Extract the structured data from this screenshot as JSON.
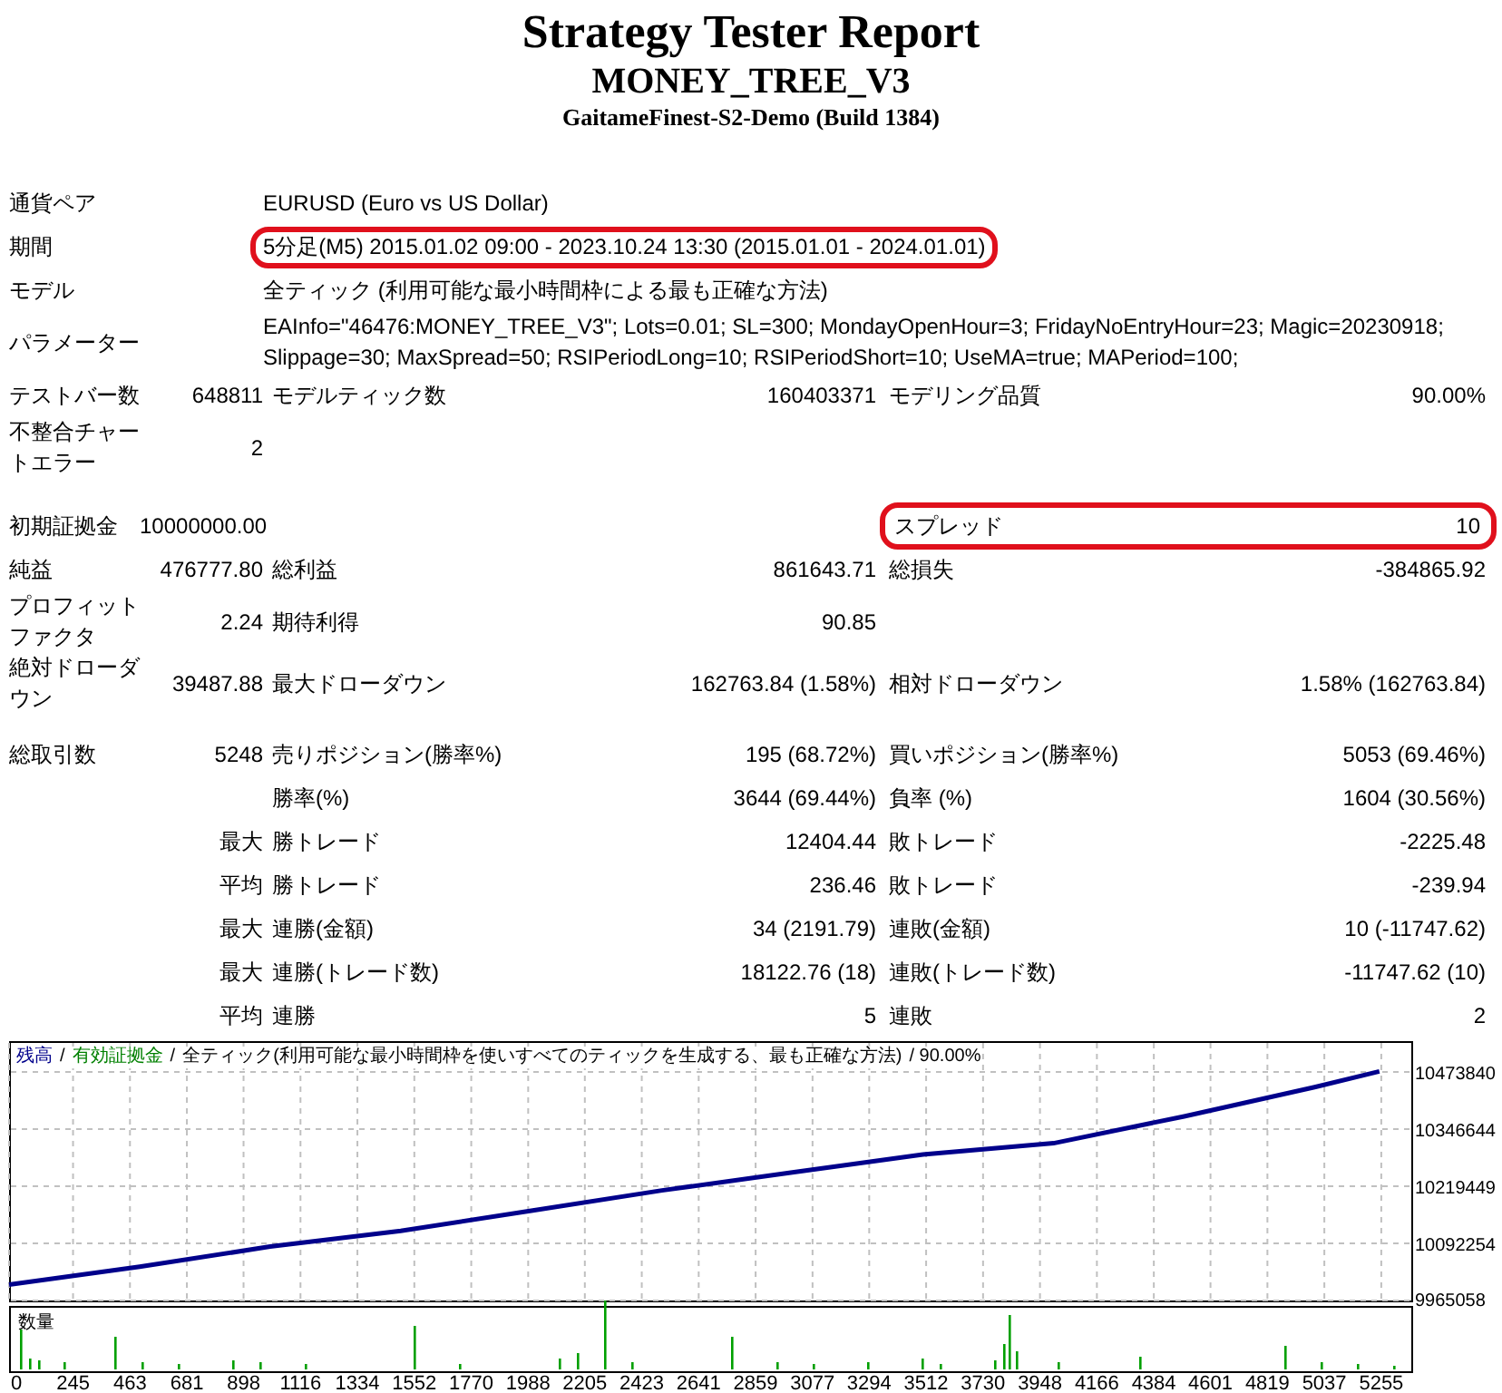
{
  "header": {
    "title": "Strategy Tester Report",
    "subtitle": "MONEY_TREE_V3",
    "server": "GaitameFinest-S2-Demo (Build 1384)"
  },
  "settings": [
    {
      "label": "通貨ペア",
      "value": "EURUSD (Euro vs US Dollar)",
      "highlighted": false
    },
    {
      "label": "期間",
      "value": "5分足(M5) 2015.01.02 09:00 - 2023.10.24 13:30 (2015.01.01 - 2024.01.01)",
      "highlighted": true
    },
    {
      "label": "モデル",
      "value": "全ティック (利用可能な最小時間枠による最も正確な方法)",
      "highlighted": false
    },
    {
      "label": "パラメーター",
      "value": "EAInfo=\"46476:MONEY_TREE_V3\"; Lots=0.01; SL=300; MondayOpenHour=3; FridayNoEntryHour=23; Magic=20230918; Slippage=30; MaxSpread=50; RSIPeriodLong=10; RSIPeriodShort=10; UseMA=true; MAPeriod=100;",
      "highlighted": false
    }
  ],
  "stat_groups": [
    [
      {
        "label_1": "テストバー数",
        "value_1": "648811",
        "label_2": "モデルティック数",
        "value_2": "160403371",
        "label_3": "モデリング品質",
        "value_3": "90.00%",
        "highlighted_3": false
      },
      {
        "label_1": "不整合チャートエラー",
        "value_1": "2",
        "highlighted_3": false
      }
    ],
    [
      {
        "label_1": "初期証拠金",
        "value_1": "10000000.00",
        "label_3": "スプレッド",
        "value_3": "10",
        "highlighted_3": true
      },
      {
        "label_1": "純益",
        "value_1": "476777.80",
        "label_2": "総利益",
        "value_2": "861643.71",
        "label_3": "総損失",
        "value_3": "-384865.92",
        "highlighted_3": false
      },
      {
        "label_1": "プロフィットファクタ",
        "value_1": "2.24",
        "label_2": "期待利得",
        "value_2": "90.85",
        "highlighted_3": false
      },
      {
        "label_1": "絶対ドローダウン",
        "value_1": "39487.88",
        "label_2": "最大ドローダウン",
        "value_2": "162763.84 (1.58%)",
        "label_3": "相対ドローダウン",
        "value_3": "1.58% (162763.84)",
        "highlighted_3": false
      }
    ],
    [
      {
        "label_1": "総取引数",
        "value_1": "5248",
        "label_2": "売りポジション(勝率%)",
        "value_2": "195 (68.72%)",
        "label_3": "買いポジション(勝率%)",
        "value_3": "5053 (69.46%)",
        "highlighted_3": false
      },
      {
        "label_2": "勝率(%)",
        "value_2": "3644 (69.44%)",
        "label_3": "負率 (%)",
        "value_3": "1604 (30.56%)",
        "highlighted_3": false
      },
      {
        "value_1": "最大",
        "label_2": "勝トレード",
        "value_2": "12404.44",
        "label_3": "敗トレード",
        "value_3": "-2225.48",
        "highlighted_3": false
      },
      {
        "value_1": "平均",
        "label_2": "勝トレード",
        "value_2": "236.46",
        "label_3": "敗トレード",
        "value_3": "-239.94",
        "highlighted_3": false
      },
      {
        "value_1": "最大",
        "label_2": "連勝(金額)",
        "value_2": "34 (2191.79)",
        "label_3": "連敗(金額)",
        "value_3": "10 (-11747.62)",
        "highlighted_3": false
      },
      {
        "value_1": "最大",
        "label_2": "連勝(トレード数)",
        "value_2": "18122.76 (18)",
        "label_3": "連敗(トレード数)",
        "value_3": "-11747.62 (10)",
        "highlighted_3": false
      },
      {
        "value_1": "平均",
        "label_2": "連勝",
        "value_2": "5",
        "label_3": "連敗",
        "value_3": "2",
        "highlighted_3": false
      }
    ]
  ],
  "chart": {
    "legend": [
      {
        "text": "/",
        "color": "#000000"
      },
      {
        "text": "有効証拠金",
        "color": "#008000"
      },
      {
        "text": "/",
        "color": "#000000"
      },
      {
        "text": "全ティック(利用可能な最小時間枠を使いすべてのティックを生成する、最も正確な方法)",
        "color": "#000000"
      },
      {
        "text": "/ 90.00%",
        "color": "#000000"
      }
    ],
    "volume_label": "数量",
    "chart_data": {
      "type": "line",
      "x": [
        0,
        500,
        1000,
        1500,
        2000,
        2500,
        3000,
        3500,
        4000,
        4500,
        5000,
        5248
      ],
      "series": [
        {
          "name": "残高",
          "color": "#00008b",
          "values": [
            10000000,
            10040000,
            10085000,
            10120000,
            10165000,
            10210000,
            10250000,
            10290000,
            10315000,
            10375000,
            10440000,
            10475000
          ]
        }
      ],
      "grid": true,
      "xlim": [
        0,
        5370
      ],
      "ylim": [
        9965058,
        10542500
      ],
      "xticks": [
        0,
        245,
        463,
        681,
        898,
        1116,
        1334,
        1552,
        1770,
        1988,
        2205,
        2423,
        2641,
        2859,
        3077,
        3294,
        3512,
        3730,
        3948,
        4166,
        4384,
        4601,
        4819,
        5037,
        5255
      ],
      "yticks": [
        9965058,
        10092254,
        10219449,
        10346644,
        10473840
      ]
    }
  }
}
